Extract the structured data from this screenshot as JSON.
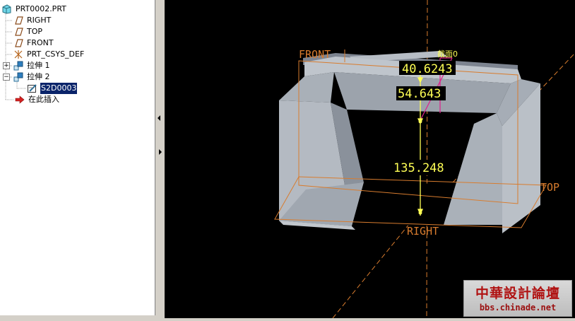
{
  "model_tree": {
    "items": [
      {
        "label": "PRT0002.PRT",
        "icon": "part-icon"
      },
      {
        "label": "RIGHT",
        "icon": "datum-plane-icon"
      },
      {
        "label": "TOP",
        "icon": "datum-plane-icon"
      },
      {
        "label": "FRONT",
        "icon": "datum-plane-icon"
      },
      {
        "label": "PRT_CSYS_DEF",
        "icon": "coordinate-system-icon"
      },
      {
        "label": "拉伸 1",
        "icon": "extrude-icon",
        "expander": "+"
      },
      {
        "label": "拉伸 2",
        "icon": "extrude-icon",
        "expander": "−"
      },
      {
        "label": "S2D0003",
        "icon": "sketch-icon",
        "selected": true
      },
      {
        "label": "在此插入",
        "icon": "insert-here-arrow-icon"
      }
    ]
  },
  "viewport": {
    "datum_labels": {
      "front": "FRONT",
      "top": "TOP",
      "right": "RIGHT"
    },
    "dimensions": [
      "40.6243",
      "54.643",
      "135.248"
    ],
    "section_label": "截面0",
    "colors": {
      "background": "#000000",
      "datum": "#d87c2e",
      "dimension": "#ffff55",
      "model": "#a6adb6",
      "constraint": "#e0208c"
    }
  },
  "watermark": {
    "title": "中華設計論壇",
    "url": "bbs.chinade.net"
  }
}
